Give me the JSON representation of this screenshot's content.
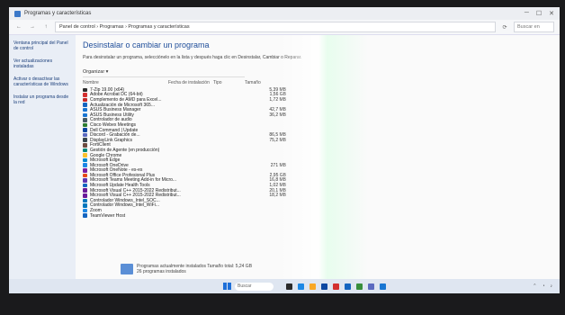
{
  "window": {
    "title": "Programas y características"
  },
  "nav": {
    "address": "Panel de control  ›  Programas  ›  Programas y características",
    "search_placeholder": "Buscar en"
  },
  "sidebar": {
    "items": [
      {
        "label": "Ventana principal del Panel de control"
      },
      {
        "label": "Ver actualizaciones instaladas"
      },
      {
        "label": "Activar o desactivar las características de Windows"
      },
      {
        "label": "Instalar un programa desde la red"
      }
    ]
  },
  "main": {
    "heading": "Desinstalar o cambiar un programa",
    "description": "Para desinstalar un programa, selecciónelo en la lista y después haga clic en Desinstalar, Cambiar o Reparar.",
    "organize_label": "Organizar ▾",
    "columns": [
      "Nombre",
      "Fecha de instalación",
      "Tipo",
      "Tamaño"
    ],
    "programs": [
      {
        "name": "7-Zip 19.00 (x64)",
        "size": "5,39 MB",
        "color": "#2c2c2c"
      },
      {
        "name": "Adobe Acrobat DC (64-bit)",
        "size": "1,56 GB",
        "color": "#d32f2f"
      },
      {
        "name": "Complemento de AMD para Excel...",
        "size": "1,72 MB",
        "color": "#c62828"
      },
      {
        "name": "Actualización de Microsoft 365...",
        "size": "",
        "color": "#1565c0"
      },
      {
        "name": "ASUS Business Manager",
        "size": "42,7 MB",
        "color": "#1976d2"
      },
      {
        "name": "ASUS Business Utility",
        "size": "36,2 MB",
        "color": "#1976d2"
      },
      {
        "name": "Controlador de audio",
        "size": "",
        "color": "#455a64"
      },
      {
        "name": "Cisco Webex Meetings",
        "size": "",
        "color": "#2e7d32"
      },
      {
        "name": "Dell Command | Update",
        "size": "",
        "color": "#0d47a1"
      },
      {
        "name": "Discord - Grabación de...",
        "size": "86,5 MB",
        "color": "#5c6bc0"
      },
      {
        "name": "DisplayLink Graphics",
        "size": "75,2 MB",
        "color": "#37474f"
      },
      {
        "name": "FortiClient",
        "size": "",
        "color": "#6d4c41"
      },
      {
        "name": "Gestión de Agente (en producción)",
        "size": "",
        "color": "#00897b"
      },
      {
        "name": "Google Chrome",
        "size": "",
        "color": "#fbc02d"
      },
      {
        "name": "Microsoft Edge",
        "size": "",
        "color": "#0288d1"
      },
      {
        "name": "Microsoft OneDrive",
        "size": "271 MB",
        "color": "#1e88e5"
      },
      {
        "name": "Microsoft OneNote - es-es",
        "size": "",
        "color": "#7b1fa2"
      },
      {
        "name": "Microsoft Office Profesional Plus",
        "size": "2,95 GB",
        "color": "#e64a19"
      },
      {
        "name": "Microsoft Teams Meeting Add-in for Micro...",
        "size": "16,8 MB",
        "color": "#5e35b1"
      },
      {
        "name": "Microsoft Update Health Tools",
        "size": "1,02 MB",
        "color": "#1565c0"
      },
      {
        "name": "Microsoft Visual C++ 2015-2022 Redistribut...",
        "size": "20,1 MB",
        "color": "#6a1b9a"
      },
      {
        "name": "Microsoft Visual C++ 2015-2022 Redistribut...",
        "size": "18,2 MB",
        "color": "#6a1b9a"
      },
      {
        "name": "Controlador Windows_Intel_SOC...",
        "size": "",
        "color": "#0277bd"
      },
      {
        "name": "Controlador Windows_Intel_WiFi...",
        "size": "",
        "color": "#0277bd"
      },
      {
        "name": "Zoom",
        "size": "",
        "color": "#1e88e5"
      },
      {
        "name": "TeamViewer Host",
        "size": "",
        "color": "#1565c0"
      }
    ]
  },
  "statusbar": {
    "line1": "Programas actualmente instalados   Tamaño total: 5,24 GB",
    "line2": "26 programas instalados"
  },
  "taskbar": {
    "search_label": "Buscar"
  }
}
